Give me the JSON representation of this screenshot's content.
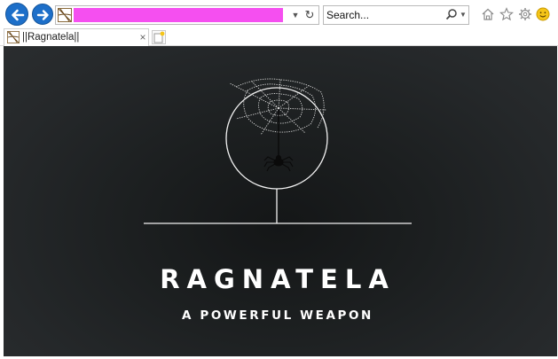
{
  "browser": {
    "nav": {
      "back_icon": "arrow-left-icon",
      "forward_icon": "arrow-right-icon"
    },
    "address": {
      "site_icon": "spiderweb-favicon",
      "url_redacted": true,
      "dropdown_icon": "chevron-down-icon",
      "refresh_icon": "refresh-icon"
    },
    "search": {
      "placeholder": "Search...",
      "search_icon": "magnifier-icon",
      "dropdown_icon": "chevron-down-icon"
    },
    "toolbar": [
      "home-icon",
      "star-icon",
      "gear-icon",
      "smiley-icon"
    ],
    "tabs": [
      {
        "title": "||Ragnatela||",
        "close": "×"
      }
    ],
    "new_tab_icon": "new-tab-icon"
  },
  "page": {
    "title": "RAGNATELA",
    "tagline": "A POWERFUL WEAPON",
    "logo_icon": "spider-web-logo",
    "colors": {
      "background": "#25282a",
      "foreground": "#ffffff",
      "redaction": "#f54ff0",
      "browser_accent": "#1d6fc9"
    }
  }
}
